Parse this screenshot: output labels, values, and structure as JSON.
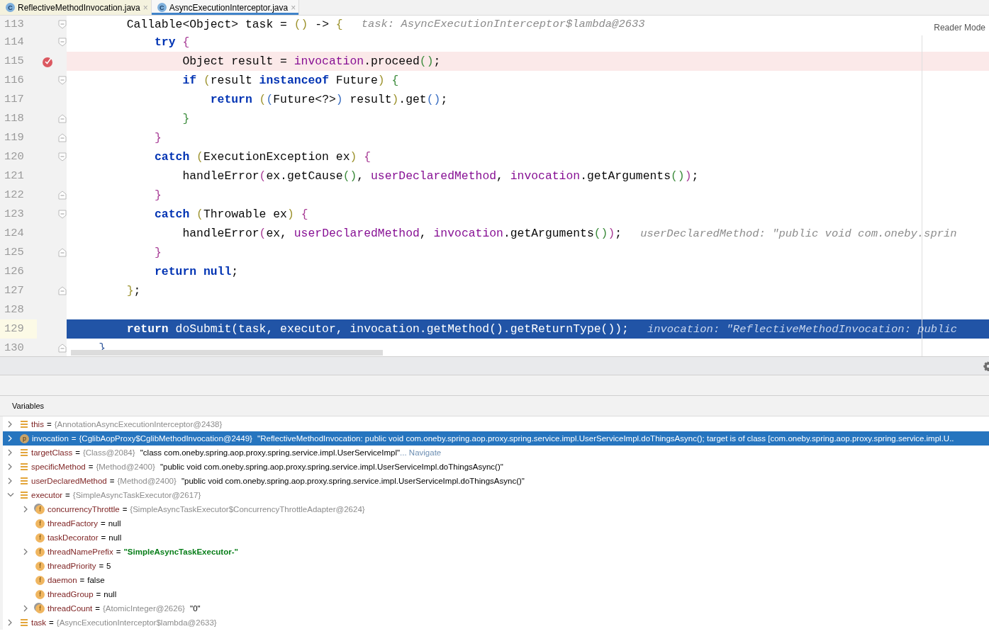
{
  "tabs": [
    {
      "label": "ReflectiveMethodInvocation.java",
      "icon_letter": "C",
      "close": "×",
      "selected": false
    },
    {
      "label": "AsyncExecutionInterceptor.java",
      "icon_letter": "C",
      "close": "×",
      "selected": true
    }
  ],
  "editor": {
    "reader_mode": "Reader Mode",
    "lines": [
      {
        "number": "113",
        "fold": {
          "kind": "start"
        },
        "breakpoint": false,
        "current": false,
        "tokens": [
          {
            "kind": "plain",
            "text": "        Callable<Object> task = "
          },
          {
            "kind": "b1",
            "text": "()"
          },
          {
            "kind": "plain",
            "text": " -> "
          },
          {
            "kind": "b1",
            "text": "{"
          }
        ],
        "hint": "task: AsyncExecutionInterceptor$lambda@2633"
      },
      {
        "number": "114",
        "fold": {
          "kind": "start"
        },
        "breakpoint": false,
        "current": false,
        "tokens": [
          {
            "kind": "kw",
            "text": "            try"
          },
          {
            "kind": "b2",
            "text": " {"
          }
        ]
      },
      {
        "number": "115",
        "breakpoint": true,
        "current": false,
        "tokens": [
          {
            "kind": "plain",
            "text": "                Object result = "
          },
          {
            "kind": "field",
            "text": "invocation"
          },
          {
            "kind": "plain",
            "text": ".proceed"
          },
          {
            "kind": "b3",
            "text": "()"
          },
          {
            "kind": "plain",
            "text": ";"
          }
        ]
      },
      {
        "number": "116",
        "fold": {
          "kind": "start"
        },
        "breakpoint": false,
        "current": false,
        "tokens": [
          {
            "kind": "kw",
            "text": "                if"
          },
          {
            "kind": "b1",
            "text": " ("
          },
          {
            "kind": "plain",
            "text": "result "
          },
          {
            "kind": "kw",
            "text": "instanceof"
          },
          {
            "kind": "plain",
            "text": " Future"
          },
          {
            "kind": "b1",
            "text": ")"
          },
          {
            "kind": "b3",
            "text": " {"
          }
        ]
      },
      {
        "number": "117",
        "breakpoint": false,
        "current": false,
        "tokens": [
          {
            "kind": "kw",
            "text": "                    return"
          },
          {
            "kind": "b1",
            "text": " ("
          },
          {
            "kind": "b4",
            "text": "("
          },
          {
            "kind": "plain",
            "text": "Future<?>"
          },
          {
            "kind": "b4",
            "text": ")"
          },
          {
            "kind": "plain",
            "text": " result"
          },
          {
            "kind": "b1",
            "text": ")"
          },
          {
            "kind": "plain",
            "text": ".get"
          },
          {
            "kind": "b4",
            "text": "()"
          },
          {
            "kind": "plain",
            "text": ";"
          }
        ]
      },
      {
        "number": "118",
        "fold": {
          "kind": "end"
        },
        "breakpoint": false,
        "current": false,
        "tokens": [
          {
            "kind": "b3",
            "text": "                }"
          }
        ]
      },
      {
        "number": "119",
        "fold": {
          "kind": "end"
        },
        "breakpoint": false,
        "current": false,
        "tokens": [
          {
            "kind": "b2",
            "text": "            }"
          }
        ]
      },
      {
        "number": "120",
        "fold": {
          "kind": "start"
        },
        "breakpoint": false,
        "current": false,
        "tokens": [
          {
            "kind": "kw",
            "text": "            catch"
          },
          {
            "kind": "b1",
            "text": " ("
          },
          {
            "kind": "plain",
            "text": "ExecutionException ex"
          },
          {
            "kind": "b1",
            "text": ")"
          },
          {
            "kind": "b2",
            "text": " {"
          }
        ]
      },
      {
        "number": "121",
        "breakpoint": false,
        "current": false,
        "tokens": [
          {
            "kind": "plain",
            "text": "                handleError"
          },
          {
            "kind": "b2",
            "text": "("
          },
          {
            "kind": "plain",
            "text": "ex.getCause"
          },
          {
            "kind": "b3",
            "text": "()"
          },
          {
            "kind": "plain",
            "text": ", "
          },
          {
            "kind": "field",
            "text": "userDeclaredMethod"
          },
          {
            "kind": "plain",
            "text": ", "
          },
          {
            "kind": "field",
            "text": "invocation"
          },
          {
            "kind": "plain",
            "text": ".getArguments"
          },
          {
            "kind": "b3",
            "text": "()"
          },
          {
            "kind": "b2",
            "text": ")"
          },
          {
            "kind": "plain",
            "text": ";"
          }
        ]
      },
      {
        "number": "122",
        "fold": {
          "kind": "end"
        },
        "breakpoint": false,
        "current": false,
        "tokens": [
          {
            "kind": "b2",
            "text": "            }"
          }
        ]
      },
      {
        "number": "123",
        "fold": {
          "kind": "start"
        },
        "breakpoint": false,
        "current": false,
        "tokens": [
          {
            "kind": "kw",
            "text": "            catch"
          },
          {
            "kind": "b1",
            "text": " ("
          },
          {
            "kind": "plain",
            "text": "Throwable ex"
          },
          {
            "kind": "b1",
            "text": ")"
          },
          {
            "kind": "b2",
            "text": " {"
          }
        ]
      },
      {
        "number": "124",
        "breakpoint": false,
        "current": false,
        "tokens": [
          {
            "kind": "plain",
            "text": "                handleError"
          },
          {
            "kind": "b2",
            "text": "("
          },
          {
            "kind": "plain",
            "text": "ex, "
          },
          {
            "kind": "field",
            "text": "userDeclaredMethod"
          },
          {
            "kind": "plain",
            "text": ", "
          },
          {
            "kind": "field",
            "text": "invocation"
          },
          {
            "kind": "plain",
            "text": ".getArguments"
          },
          {
            "kind": "b3",
            "text": "()"
          },
          {
            "kind": "b2",
            "text": ")"
          },
          {
            "kind": "plain",
            "text": ";"
          }
        ],
        "hint": "userDeclaredMethod: \"public void com.oneby.sprin"
      },
      {
        "number": "125",
        "fold": {
          "kind": "end"
        },
        "breakpoint": false,
        "current": false,
        "tokens": [
          {
            "kind": "b2",
            "text": "            }"
          }
        ]
      },
      {
        "number": "126",
        "breakpoint": false,
        "current": false,
        "tokens": [
          {
            "kind": "kw",
            "text": "            return null"
          },
          {
            "kind": "plain",
            "text": ";"
          }
        ]
      },
      {
        "number": "127",
        "fold": {
          "kind": "end"
        },
        "breakpoint": false,
        "current": false,
        "tokens": [
          {
            "kind": "b1",
            "text": "        }"
          },
          {
            "kind": "plain",
            "text": ";"
          }
        ]
      },
      {
        "number": "128",
        "breakpoint": false,
        "current": false
      },
      {
        "number": "129",
        "breakpoint": false,
        "current": true,
        "tokens": [
          {
            "kind": "kw",
            "text": "        return"
          },
          {
            "kind": "plain",
            "text": " doSubmit(task, executor, invocation.getMethod().getReturnType());"
          }
        ],
        "hint": "invocation: \"ReflectiveMethodInvocation: public"
      },
      {
        "number": "130",
        "fold": {
          "kind": "end"
        },
        "breakpoint": false,
        "current": false,
        "tokens": [
          {
            "kind": "brace",
            "text": "    }"
          }
        ]
      }
    ]
  },
  "variables": {
    "title": "Variables",
    "items": [
      {
        "kind": "list",
        "name": "this",
        "operator": "=",
        "type": "{AnnotationAsyncExecutionInterceptor@2438}",
        "expanded": false,
        "selected": false
      },
      {
        "kind": "param",
        "icon_letter": "p",
        "name": "invocation",
        "operator": "=",
        "type": "{CglibAopProxy$CglibMethodInvocation@2449}",
        "value": "\"ReflectiveMethodInvocation: public void com.oneby.spring.aop.proxy.spring.service.impl.UserServiceImpl.doThingsAsync(); target is of class [com.oneby.spring.aop.proxy.spring.service.impl.U..",
        "expanded": false,
        "selected": true
      },
      {
        "kind": "list",
        "name": "targetClass",
        "operator": "=",
        "type": "{Class@2084}",
        "value": "\"class com.oneby.spring.aop.proxy.spring.service.impl.UserServiceImpl\"",
        "link": "... Navigate",
        "expanded": false,
        "selected": false
      },
      {
        "kind": "list",
        "name": "specificMethod",
        "operator": "=",
        "type": "{Method@2400}",
        "value": "\"public void com.oneby.spring.aop.proxy.spring.service.impl.UserServiceImpl.doThingsAsync()\"",
        "expanded": false,
        "selected": false
      },
      {
        "kind": "list",
        "name": "userDeclaredMethod",
        "operator": "=",
        "type": "{Method@2400}",
        "value": "\"public void com.oneby.spring.aop.proxy.spring.service.impl.UserServiceImpl.doThingsAsync()\"",
        "expanded": false,
        "selected": false
      },
      {
        "kind": "list",
        "name": "executor",
        "operator": "=",
        "type": "{SimpleAsyncTaskExecutor@2617}",
        "expanded": true,
        "selected": false,
        "children": [
          {
            "kind": "field",
            "icon_letter": "f",
            "marked": true,
            "name": "concurrencyThrottle",
            "operator": "=",
            "type": "{SimpleAsyncTaskExecutor$ConcurrencyThrottleAdapter@2624}",
            "expanded": false,
            "selected": false
          },
          {
            "kind": "field",
            "icon_letter": "f",
            "marked": false,
            "name": "threadFactory",
            "operator": "=",
            "value": "null",
            "selected": false
          },
          {
            "kind": "field",
            "icon_letter": "f",
            "marked": false,
            "name": "taskDecorator",
            "operator": "=",
            "value": "null",
            "selected": false
          },
          {
            "kind": "field",
            "icon_letter": "f",
            "marked": false,
            "name": "threadNamePrefix",
            "operator": "=",
            "value": {
              "kind": "string",
              "text": "\"SimpleAsyncTaskExecutor-\""
            },
            "expanded": false,
            "selected": false
          },
          {
            "kind": "field",
            "icon_letter": "f",
            "marked": false,
            "name": "threadPriority",
            "operator": "=",
            "value": "5",
            "selected": false
          },
          {
            "kind": "field",
            "icon_letter": "f",
            "marked": false,
            "name": "daemon",
            "operator": "=",
            "value": "false",
            "selected": false
          },
          {
            "kind": "field",
            "icon_letter": "f",
            "marked": false,
            "name": "threadGroup",
            "operator": "=",
            "value": "null",
            "selected": false
          },
          {
            "kind": "field",
            "icon_letter": "f",
            "marked": true,
            "name": "threadCount",
            "operator": "=",
            "type": "{AtomicInteger@2626}",
            "value": "\"0\"",
            "expanded": false,
            "selected": false
          }
        ]
      },
      {
        "kind": "list",
        "name": "task",
        "operator": "=",
        "type": "{AsyncExecutionInterceptor$lambda@2633}",
        "expanded": false,
        "selected": false
      }
    ]
  }
}
